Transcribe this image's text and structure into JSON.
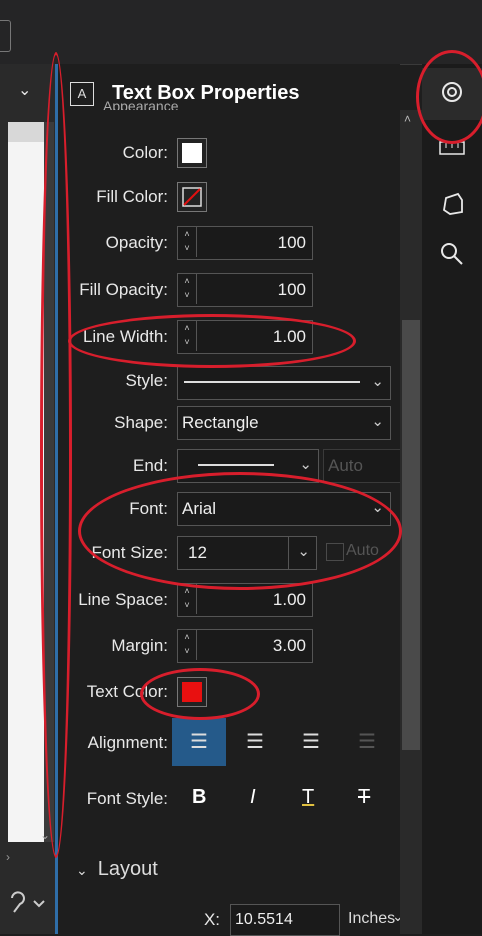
{
  "panel": {
    "title": "Text Box Properties",
    "title_icon": "A",
    "behind_title": "Appearance"
  },
  "rows": {
    "color": {
      "label": "Color:",
      "value": "#ffffff"
    },
    "fill_color": {
      "label": "Fill Color:",
      "value": "none"
    },
    "opacity": {
      "label": "Opacity:",
      "value": "100"
    },
    "fill_opacity": {
      "label": "Fill Opacity:",
      "value": "100"
    },
    "line_width": {
      "label": "Line Width:",
      "value": "1.00"
    },
    "style": {
      "label": "Style:"
    },
    "shape": {
      "label": "Shape:",
      "value": "Rectangle"
    },
    "end": {
      "label": "End:",
      "auto": "Auto"
    },
    "font": {
      "label": "Font:",
      "value": "Arial"
    },
    "font_size": {
      "label": "Font Size:",
      "value": "12",
      "auto": "Auto"
    },
    "line_space": {
      "label": "Line Space:",
      "value": "1.00"
    },
    "margin": {
      "label": "Margin:",
      "value": "3.00"
    },
    "text_color": {
      "label": "Text Color:",
      "value": "#e81010"
    },
    "alignment": {
      "label": "Alignment:"
    },
    "font_style": {
      "label": "Font Style:",
      "bold": "B",
      "italic": "I",
      "underline": "T",
      "strike": "T"
    }
  },
  "layout": {
    "section_label": "Layout",
    "x_label": "X:",
    "x_value": "10.5514",
    "unit": "Inches"
  },
  "colors": {
    "accent": "#255a8a",
    "annotation": "#d81e2c"
  }
}
